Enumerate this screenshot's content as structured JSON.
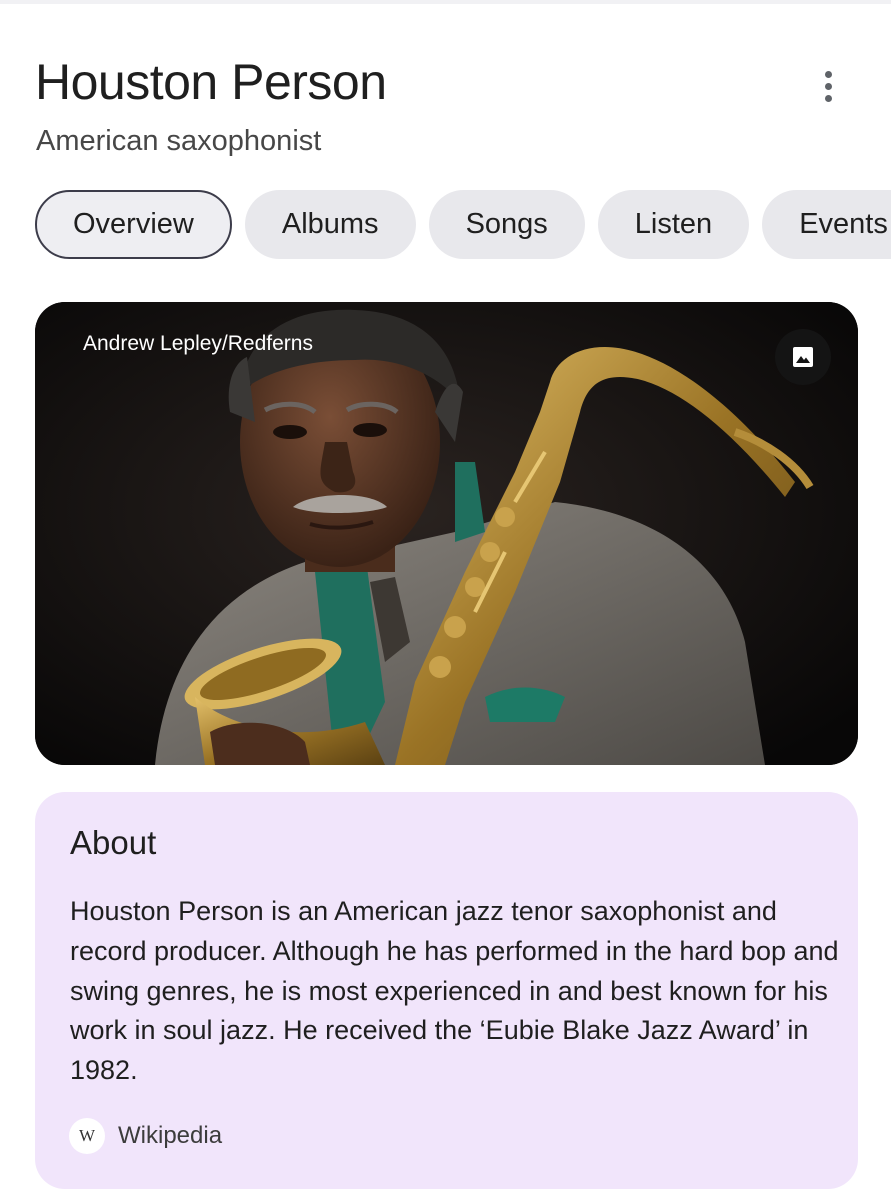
{
  "header": {
    "title": "Houston Person",
    "subtitle": "American saxophonist"
  },
  "tabs": [
    {
      "label": "Overview",
      "active": true
    },
    {
      "label": "Albums",
      "active": false
    },
    {
      "label": "Songs",
      "active": false
    },
    {
      "label": "Listen",
      "active": false
    },
    {
      "label": "Events",
      "active": false
    }
  ],
  "hero_image": {
    "credit": "Andrew Lepley/Redferns",
    "action_icon": "image-icon"
  },
  "about": {
    "heading": "About",
    "text": "Houston Person is an American jazz tenor saxophonist and record producer. Although he has performed in the hard bop and swing genres, he is most experienced in and best known for his work in soul jazz. He received the ‘Eubie Blake Jazz Award’ in 1982.",
    "source_icon_letter": "W",
    "source_label": "Wikipedia"
  },
  "colors": {
    "about_background": "#f1e5fb",
    "chip_background": "#e8e8ec",
    "active_chip_border": "#3c3c4a"
  }
}
